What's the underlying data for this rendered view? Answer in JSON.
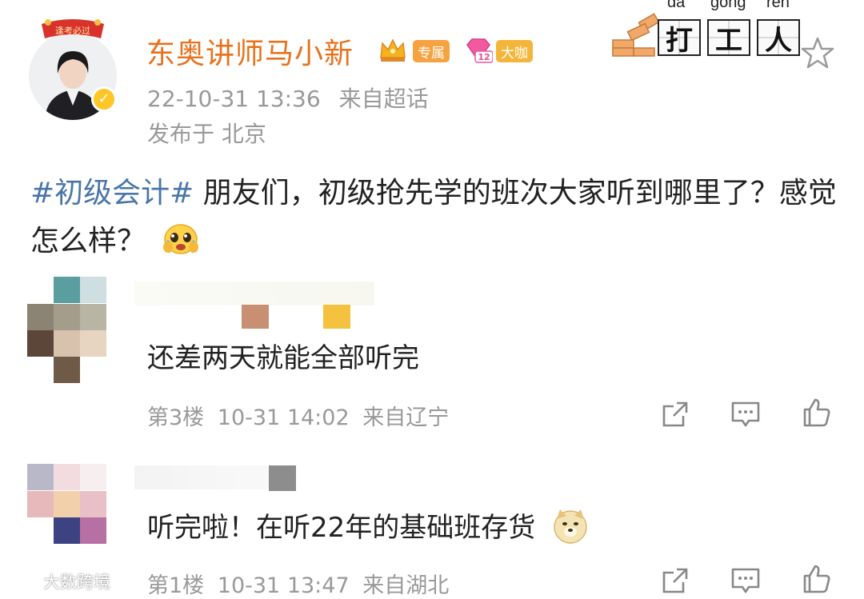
{
  "post": {
    "author_name": "东奥讲师马小新",
    "avatar_ribbon_text": "逢考必过",
    "badges": {
      "exclusive_label": "专属",
      "level_label": "12",
      "vip_label": "大咖"
    },
    "timestamp": "22-10-31 13:36",
    "source": "来自超话",
    "location": "发布于 北京",
    "hashtag": "#初级会计#",
    "content": " 朋友们，初级抢先学的班次大家听到哪里了？感觉怎么样？"
  },
  "sticker": {
    "pinyin": [
      "da",
      "gong",
      "ren"
    ],
    "chars": [
      "打",
      "工",
      "人"
    ]
  },
  "comments": [
    {
      "text": "还差两天就能全部听完",
      "floor": "第3楼",
      "time": "10-31 14:02",
      "source": "来自辽宁"
    },
    {
      "text": "听完啦！在听22年的基础班存货",
      "floor": "第1楼",
      "time": "10-31 13:47",
      "source": "来自湖北"
    }
  ],
  "watermark": "大数跨境",
  "colors": {
    "author": "#e8711b",
    "hashtag": "#4a76a8",
    "meta": "#999999"
  },
  "icons": [
    "crown-icon",
    "level-diamond-icon",
    "star-icon",
    "share-icon",
    "comment-icon",
    "like-icon",
    "cry-emoji-icon",
    "doge-emoji-icon"
  ]
}
